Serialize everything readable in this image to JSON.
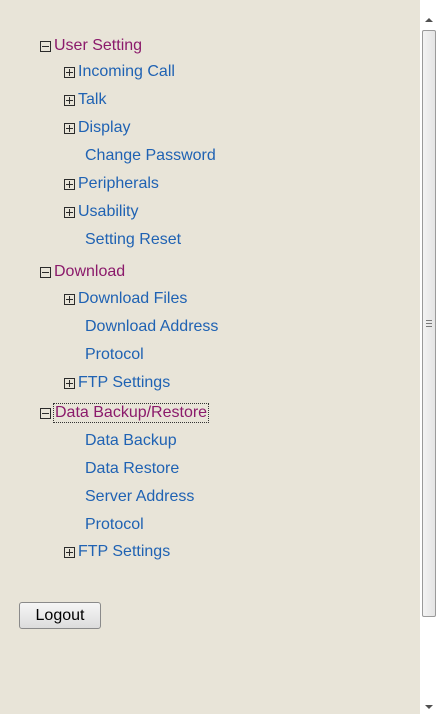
{
  "tree": {
    "user_setting": {
      "label": "User Setting",
      "incoming_call": "Incoming Call",
      "talk": "Talk",
      "display": "Display",
      "change_password": "Change Password",
      "peripherals": "Peripherals",
      "usability": "Usability",
      "setting_reset": "Setting Reset"
    },
    "download": {
      "label": "Download",
      "download_files": "Download Files",
      "download_address": "Download Address",
      "protocol": "Protocol",
      "ftp_settings": "FTP Settings"
    },
    "data_backup_restore": {
      "label": "Data Backup/Restore",
      "data_backup": "Data Backup",
      "data_restore": "Data Restore",
      "server_address": "Server Address",
      "protocol": "Protocol",
      "ftp_settings": "FTP Settings"
    }
  },
  "buttons": {
    "logout": "Logout"
  },
  "colors": {
    "background": "#e8e4d8",
    "section_label": "#8b1a6b",
    "item_link": "#1f62b3"
  }
}
